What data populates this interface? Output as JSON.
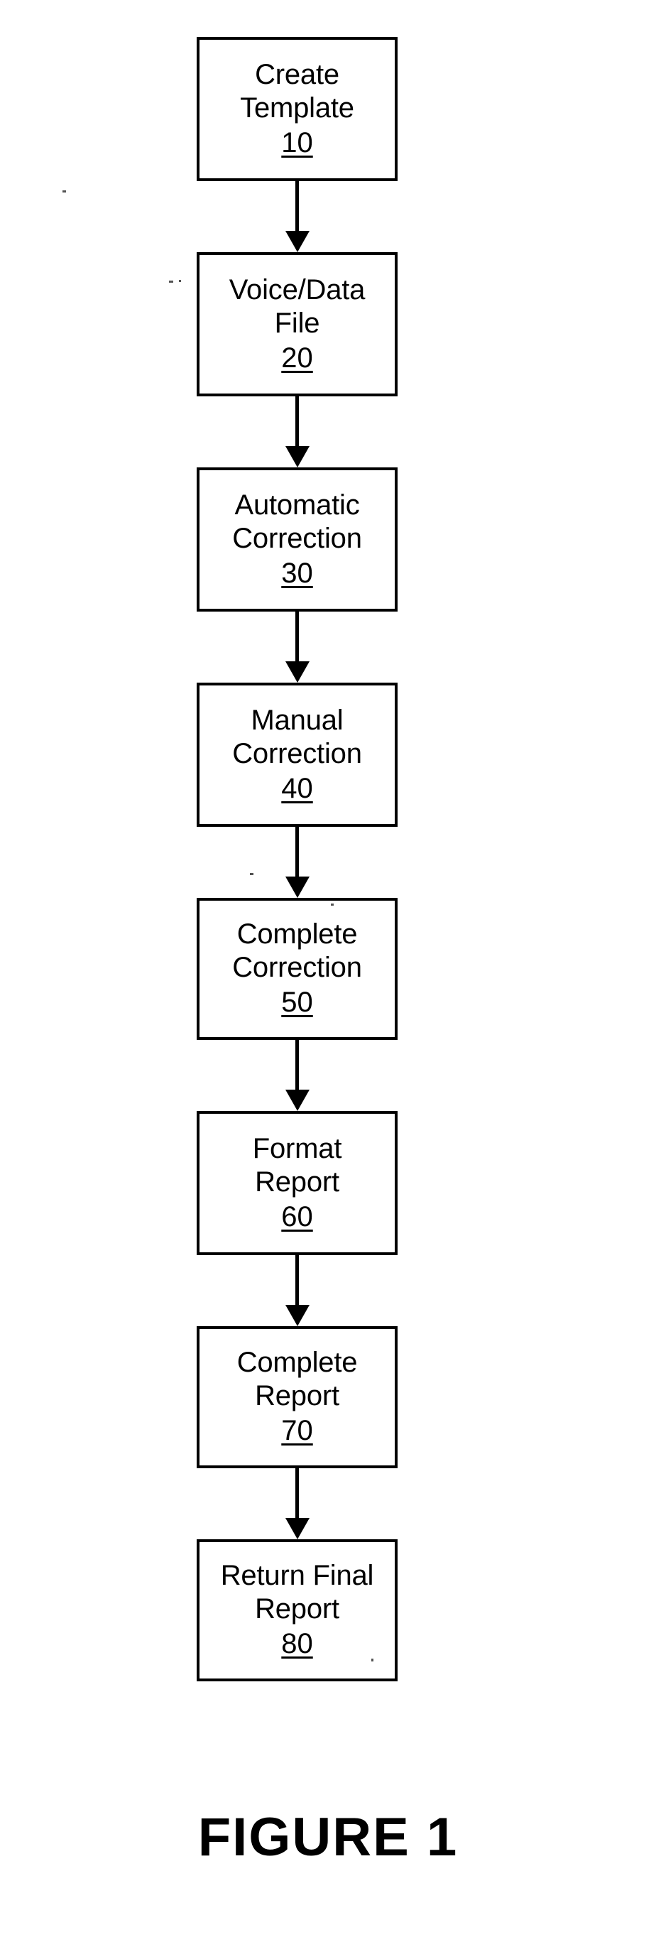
{
  "figure": {
    "caption": "FIGURE 1",
    "ink_color": "#000000",
    "background_color": "#ffffff"
  },
  "flowchart": {
    "orientation": "vertical-top-to-bottom",
    "connector_type": "solid-line-with-filled-arrowhead",
    "nodes": [
      {
        "ref": "10",
        "lines": [
          "Create",
          "Template"
        ],
        "line1": "Create",
        "line2": "Template"
      },
      {
        "ref": "20",
        "lines": [
          "Voice/Data",
          "File"
        ],
        "line1": "Voice/Data",
        "line2": "File"
      },
      {
        "ref": "30",
        "lines": [
          "Automatic",
          "Correction"
        ],
        "line1": "Automatic",
        "line2": "Correction"
      },
      {
        "ref": "40",
        "lines": [
          "Manual",
          "Correction"
        ],
        "line1": "Manual",
        "line2": "Correction"
      },
      {
        "ref": "50",
        "lines": [
          "Complete",
          "Correction"
        ],
        "line1": "Complete",
        "line2": "Correction"
      },
      {
        "ref": "60",
        "lines": [
          "Format",
          "Report"
        ],
        "line1": "Format",
        "line2": "Report"
      },
      {
        "ref": "70",
        "lines": [
          "Complete",
          "Report"
        ],
        "line1": "Complete",
        "line2": "Report"
      },
      {
        "ref": "80",
        "lines": [
          "Return Final",
          "Report"
        ],
        "line1": "Return Final",
        "line2": "Report"
      }
    ]
  }
}
